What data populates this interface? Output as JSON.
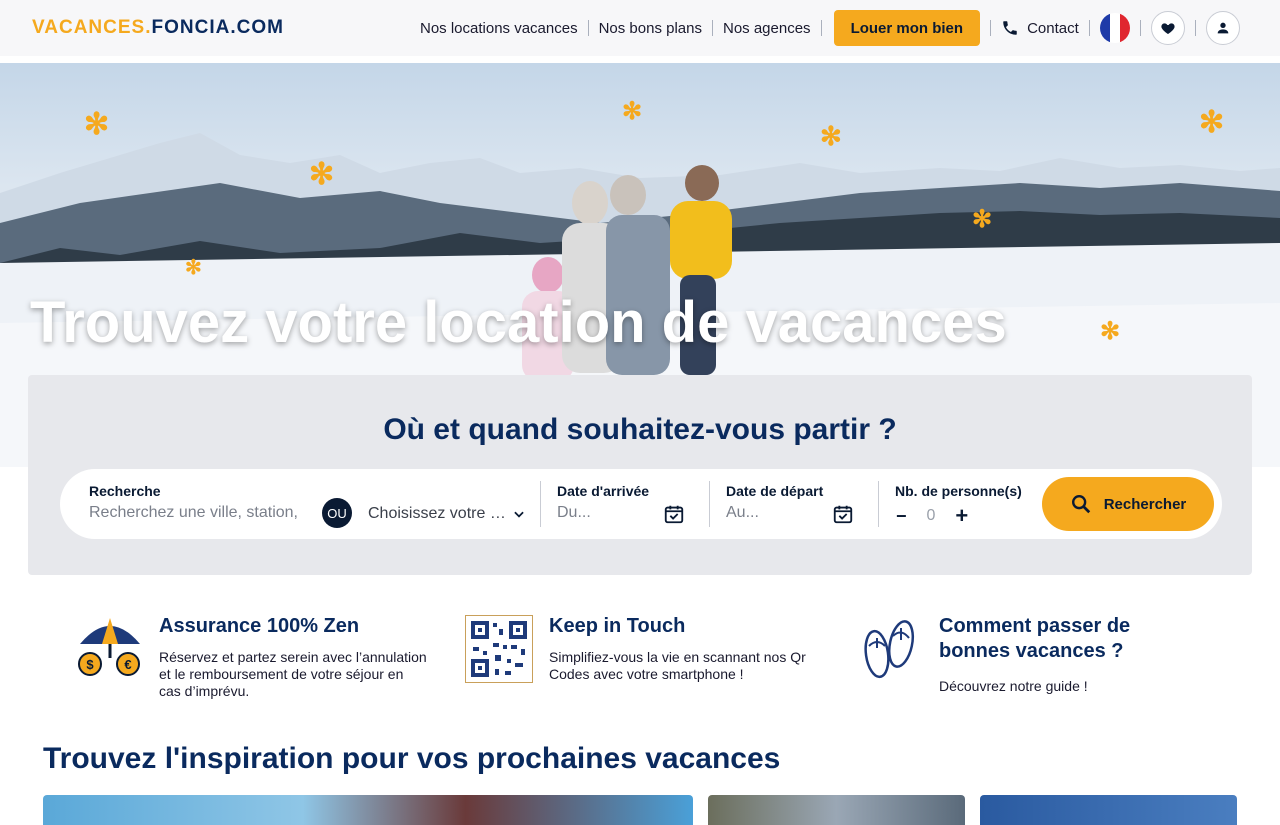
{
  "header": {
    "logo_left": "VACANCES.",
    "logo_mid": "FONCIA",
    "logo_right": ".COM",
    "nav": [
      "Nos locations vacances",
      "Nos bons plans",
      "Nos agences"
    ],
    "cta": "Louer mon bien",
    "contact": "Contact"
  },
  "hero": {
    "title": "Trouvez votre location de vacances"
  },
  "search": {
    "title": "Où et quand souhaitez-vous partir ?",
    "recherche_label": "Recherche",
    "recherche_placeholder": "Recherchez une ville, station,",
    "ou": "OU",
    "destination_select": "Choisissez votre …",
    "arrival_label": "Date d'arrivée",
    "arrival_placeholder": "Du...",
    "departure_label": "Date de départ",
    "departure_placeholder": "Au...",
    "people_label": "Nb. de personne(s)",
    "people_minus": "−",
    "people_value": "0",
    "people_plus": "+",
    "button": "Rechercher"
  },
  "features": [
    {
      "title": "Assurance 100% Zen",
      "text": "Réservez et partez serein avec l’annulation et le remboursement de votre séjour en cas d’imprévu.",
      "icon": "umbrella-euro-dollar-icon"
    },
    {
      "title": "Keep in Touch",
      "text": "Simplifiez-vous la vie en scannant nos Qr Codes avec votre smartphone !",
      "icon": "qr-code-icon"
    },
    {
      "title": "Comment passer de bonnes vacances ?",
      "text": "Découvrez notre guide !",
      "icon": "flip-flops-icon"
    }
  ],
  "inspiration": {
    "title": "Trouvez l'inspiration pour vos prochaines vacances"
  },
  "colors": {
    "brand_orange": "#f5a91e",
    "brand_navy": "#0a2a5e"
  }
}
